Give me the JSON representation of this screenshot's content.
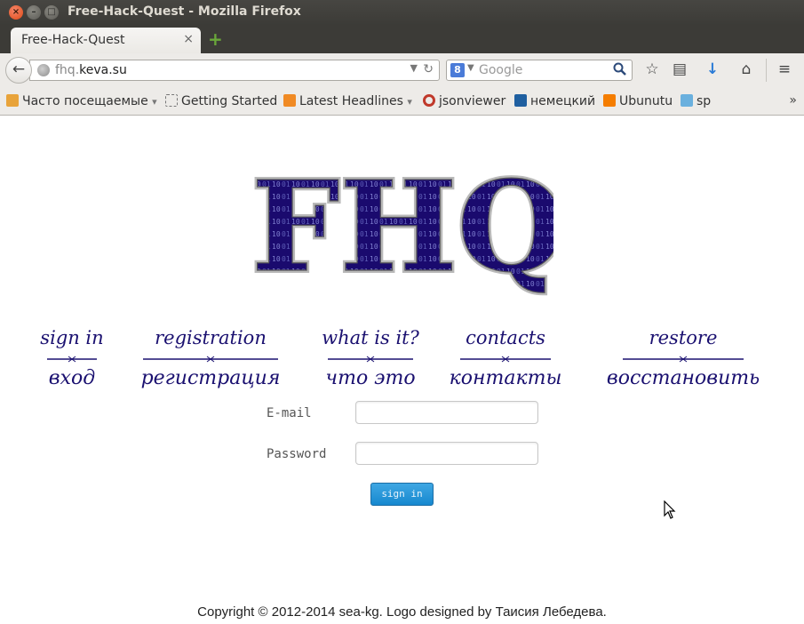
{
  "window": {
    "title": "Free-Hack-Quest - Mozilla Firefox",
    "close_glyph": "×",
    "min_glyph": "–",
    "max_glyph": "□"
  },
  "tabs": [
    {
      "label": "Free-Hack-Quest",
      "close_glyph": "×",
      "active": true
    }
  ],
  "new_tab_glyph": "+",
  "navbar": {
    "back_glyph": "←",
    "url_prefix": "fhq.",
    "url_domain": "keva.su",
    "url_drop_glyph": "▼",
    "reload_glyph": "↻",
    "search_engine_glyph": "8",
    "search_drop_glyph": "▼",
    "search_placeholder": "Google",
    "search_glyph": "⚲",
    "icons": [
      "star-icon",
      "reading-list-icon",
      "download-icon",
      "home-icon",
      "menu-icon"
    ],
    "icon_glyphs": {
      "star": "☆",
      "reading": "▤",
      "download": "↓",
      "home": "⌂",
      "menu": "≡"
    }
  },
  "bookmarks": {
    "items": [
      {
        "label": "Часто посещаемые",
        "icon": "folder-icon",
        "has_dropdown": true
      },
      {
        "label": "Getting Started",
        "icon": "page-icon"
      },
      {
        "label": "Latest Headlines",
        "icon": "rss-icon",
        "has_dropdown": true
      },
      {
        "label": "jsonviewer",
        "icon": "jsonviewer-icon"
      },
      {
        "label": "немецкий",
        "icon": "b-icon"
      },
      {
        "label": "Ubunutu",
        "icon": "blogger-icon"
      },
      {
        "label": "sp",
        "icon": "sp-icon"
      }
    ],
    "dropdown_glyph": "▾",
    "overflow_glyph": "»"
  },
  "logo": {
    "text": "FHQ",
    "bits": "10 01 11 00 10 01 11 0"
  },
  "menu": [
    {
      "en": "sign in",
      "ru": "вход"
    },
    {
      "en": "registration",
      "ru": "регистрация"
    },
    {
      "en": "what is it?",
      "ru": "что это"
    },
    {
      "en": "contacts",
      "ru": "контакты"
    },
    {
      "en": "restore",
      "ru": "восстановить"
    }
  ],
  "form": {
    "email_label": "E-mail",
    "email_value": "",
    "password_label": "Password",
    "password_value": "",
    "submit_label": "sign in"
  },
  "footer": "Copyright © 2012-2014 sea-kg. Logo designed by Таисия Лебедева.",
  "colors": {
    "accent_blue": "#1688cf",
    "menu_ink": "#1a1070",
    "logo_fill": "#1a0a6e",
    "titlebar": "#3c3b37",
    "close_orange": "#df4a16"
  }
}
